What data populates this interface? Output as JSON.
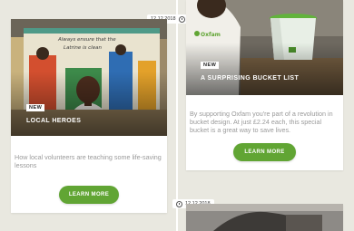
{
  "timeline": {
    "dates": [
      "12 12 2018",
      "12 12 2018"
    ]
  },
  "cards": [
    {
      "tag": "NEW",
      "title": "LOCAL HEROES",
      "mural_text": "Always ensure that the Latrine is clean",
      "description": "How local volunteers are teaching some life-saving lessons",
      "button": "LEARN MORE"
    },
    {
      "tag": "NEW",
      "title": "A SURPRISING BUCKET LIST",
      "shirt_brand": "Oxfam",
      "description": "By supporting Oxfam you're part of a revolution in bucket design. At just £2.24 each, this special bucket is a great way to save lives.",
      "button": "LEARN MORE"
    }
  ],
  "colors": {
    "background": "#e9e8e0",
    "button": "#61a534",
    "muted_text": "#9a9a9a"
  }
}
